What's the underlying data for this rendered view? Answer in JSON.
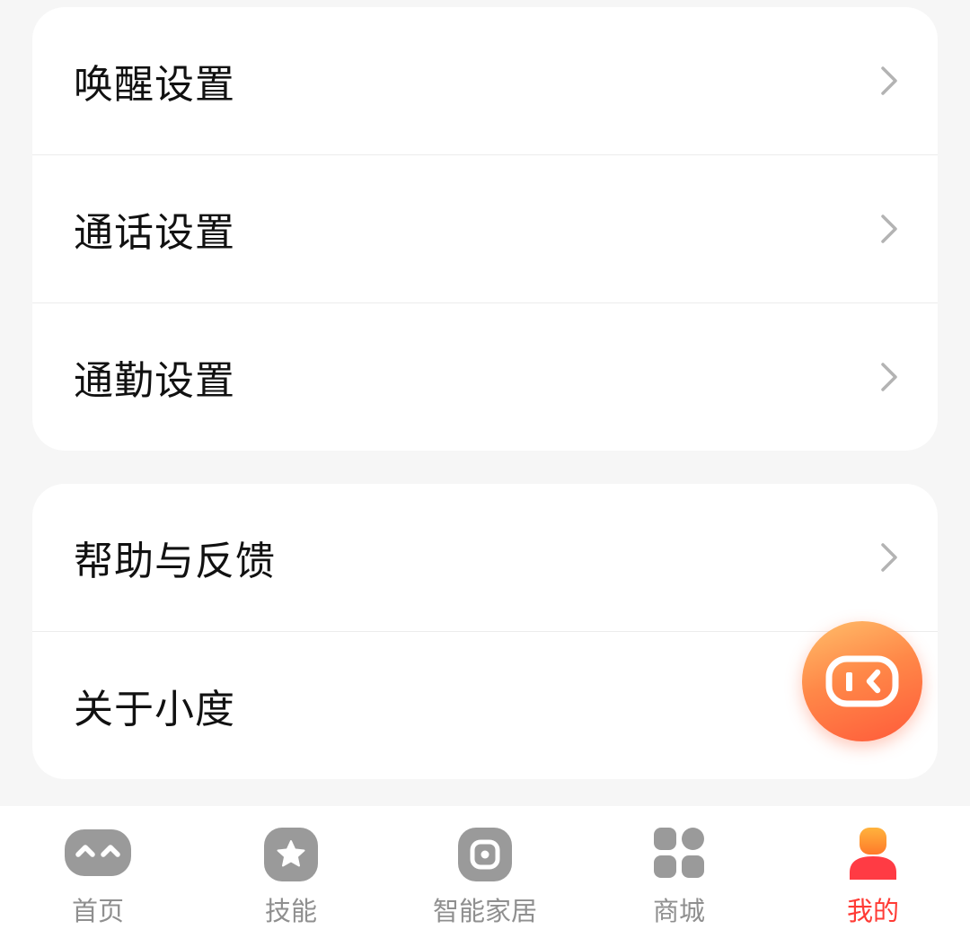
{
  "settings_group": {
    "items": [
      {
        "label": "唤醒设置"
      },
      {
        "label": "通话设置"
      },
      {
        "label": "通勤设置"
      }
    ]
  },
  "about_group": {
    "items": [
      {
        "label": "帮助与反馈"
      },
      {
        "label": "关于小度"
      }
    ]
  },
  "fab": {
    "icon": "xiaodu-assistant-icon"
  },
  "tabbar": {
    "tabs": [
      {
        "label": "首页",
        "icon": "home-face-icon",
        "active": false
      },
      {
        "label": "技能",
        "icon": "star-icon",
        "active": false
      },
      {
        "label": "智能家居",
        "icon": "smart-home-icon",
        "active": false
      },
      {
        "label": "商城",
        "icon": "grid-icon",
        "active": false
      },
      {
        "label": "我的",
        "icon": "profile-icon",
        "active": true
      }
    ]
  },
  "colors": {
    "background": "#f6f6f6",
    "card": "#ffffff",
    "active_tab": "#ff3b35",
    "inactive_tab": "#8f8f8f",
    "fab_gradient_start": "#ffbe6a",
    "fab_gradient_end": "#ff5a3a"
  }
}
